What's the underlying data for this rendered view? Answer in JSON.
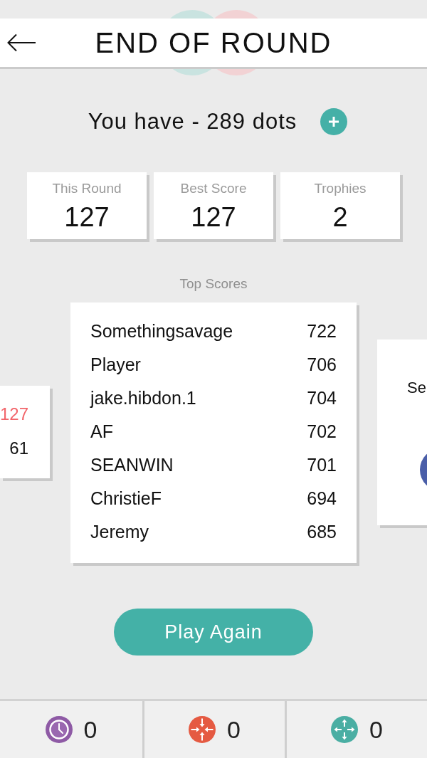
{
  "header": {
    "title": "END OF ROUND"
  },
  "balance": {
    "text": "You have - 289 dots"
  },
  "stats": [
    {
      "label": "This Round",
      "value": "127"
    },
    {
      "label": "Best Score",
      "value": "127"
    },
    {
      "label": "Trophies",
      "value": "2"
    }
  ],
  "top_scores": {
    "title": "Top Scores",
    "previous_card": {
      "rows": [
        {
          "value": "127",
          "highlighted": true
        },
        {
          "value": "61",
          "highlighted": false
        }
      ]
    },
    "rows": [
      {
        "name": "Somethingsavage",
        "score": "722"
      },
      {
        "name": "Player",
        "score": "706"
      },
      {
        "name": "jake.hibdon.1",
        "score": "704"
      },
      {
        "name": "AF",
        "score": "702"
      },
      {
        "name": "SEANWIN",
        "score": "701"
      },
      {
        "name": "ChristieF",
        "score": "694"
      },
      {
        "name": "Jeremy",
        "score": "685"
      }
    ],
    "next_card": {
      "text": "Se"
    }
  },
  "play_button": {
    "label": "Play Again"
  },
  "powerups": [
    {
      "kind": "clock",
      "count": "0"
    },
    {
      "kind": "shrink",
      "count": "0"
    },
    {
      "kind": "expand",
      "count": "0"
    }
  ]
}
